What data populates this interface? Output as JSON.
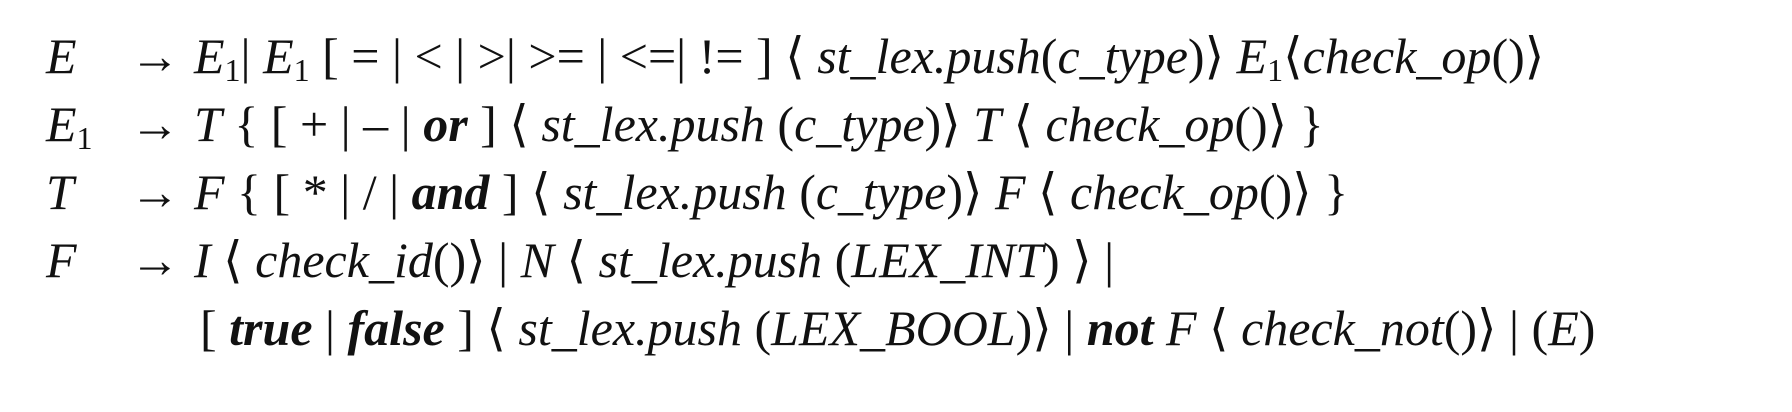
{
  "rules": [
    {
      "lhs": "E",
      "lhs_sub": "",
      "arrow": "→",
      "rhs": [
        {
          "t": "E",
          "s": "i"
        },
        {
          "t": "1",
          "s": "sub"
        },
        {
          "t": "| ",
          "s": "n"
        },
        {
          "t": "E",
          "s": "i"
        },
        {
          "t": "1",
          "s": "sub"
        },
        {
          "t": " [ = | < | >| >= | <=| != ] ⟨ ",
          "s": "n"
        },
        {
          "t": "st_lex.push",
          "s": "i"
        },
        {
          "t": "(",
          "s": "n"
        },
        {
          "t": "c_type",
          "s": "i"
        },
        {
          "t": ")⟩ ",
          "s": "n"
        },
        {
          "t": "E",
          "s": "i"
        },
        {
          "t": "1",
          "s": "sub"
        },
        {
          "t": "⟨",
          "s": "n"
        },
        {
          "t": "check_op",
          "s": "i"
        },
        {
          "t": "()⟩",
          "s": "n"
        }
      ]
    },
    {
      "lhs": "E",
      "lhs_sub": "1",
      "arrow": "→",
      "rhs": [
        {
          "t": "T",
          "s": "i"
        },
        {
          "t": " { [ + | – | ",
          "s": "n"
        },
        {
          "t": "or",
          "s": "b"
        },
        {
          "t": " ] ⟨ ",
          "s": "n"
        },
        {
          "t": "st_lex.push",
          "s": "i"
        },
        {
          "t": " (",
          "s": "n"
        },
        {
          "t": "c_type",
          "s": "i"
        },
        {
          "t": ")⟩ ",
          "s": "n"
        },
        {
          "t": "T",
          "s": "i"
        },
        {
          "t": " ⟨ ",
          "s": "n"
        },
        {
          "t": "check_op",
          "s": "i"
        },
        {
          "t": "()⟩ }",
          "s": "n"
        }
      ]
    },
    {
      "lhs": "T",
      "lhs_sub": "",
      "arrow": "→",
      "rhs": [
        {
          "t": "F",
          "s": "i"
        },
        {
          "t": " { [ * | / | ",
          "s": "n"
        },
        {
          "t": "and",
          "s": "b"
        },
        {
          "t": " ] ⟨ ",
          "s": "n"
        },
        {
          "t": "st_lex.push",
          "s": "i"
        },
        {
          "t": " (",
          "s": "n"
        },
        {
          "t": "c_type",
          "s": "i"
        },
        {
          "t": ")⟩ ",
          "s": "n"
        },
        {
          "t": "F",
          "s": "i"
        },
        {
          "t": " ⟨ ",
          "s": "n"
        },
        {
          "t": "check_op",
          "s": "i"
        },
        {
          "t": "()⟩ }",
          "s": "n"
        }
      ]
    },
    {
      "lhs": "F",
      "lhs_sub": "",
      "arrow": "→",
      "rhs": [
        {
          "t": "I",
          "s": "i"
        },
        {
          "t": " ⟨ ",
          "s": "n"
        },
        {
          "t": "check_id",
          "s": "i"
        },
        {
          "t": "()⟩ | ",
          "s": "n"
        },
        {
          "t": "N",
          "s": "i"
        },
        {
          "t": " ⟨ ",
          "s": "n"
        },
        {
          "t": "st_lex.push",
          "s": "i"
        },
        {
          "t": " (",
          "s": "n"
        },
        {
          "t": "LEX_INT",
          "s": "i"
        },
        {
          "t": ") ⟩ |",
          "s": "n"
        }
      ]
    },
    {
      "lhs": "",
      "lhs_sub": "",
      "arrow": "",
      "rhs": [
        {
          "t": "[ ",
          "s": "n"
        },
        {
          "t": "true",
          "s": "b"
        },
        {
          "t": " | ",
          "s": "n"
        },
        {
          "t": "false",
          "s": "b"
        },
        {
          "t": " ] ⟨ ",
          "s": "n"
        },
        {
          "t": "st_lex.push",
          "s": "i"
        },
        {
          "t": " (",
          "s": "n"
        },
        {
          "t": "LEX_BOOL",
          "s": "i"
        },
        {
          "t": ")⟩ | ",
          "s": "n"
        },
        {
          "t": "not",
          "s": "b"
        },
        {
          "t": " ",
          "s": "n"
        },
        {
          "t": "F",
          "s": "i"
        },
        {
          "t": " ⟨ ",
          "s": "n"
        },
        {
          "t": "check_not",
          "s": "i"
        },
        {
          "t": "()⟩ | (",
          "s": "n"
        },
        {
          "t": "E",
          "s": "i"
        },
        {
          "t": ")",
          "s": "n"
        }
      ]
    }
  ]
}
